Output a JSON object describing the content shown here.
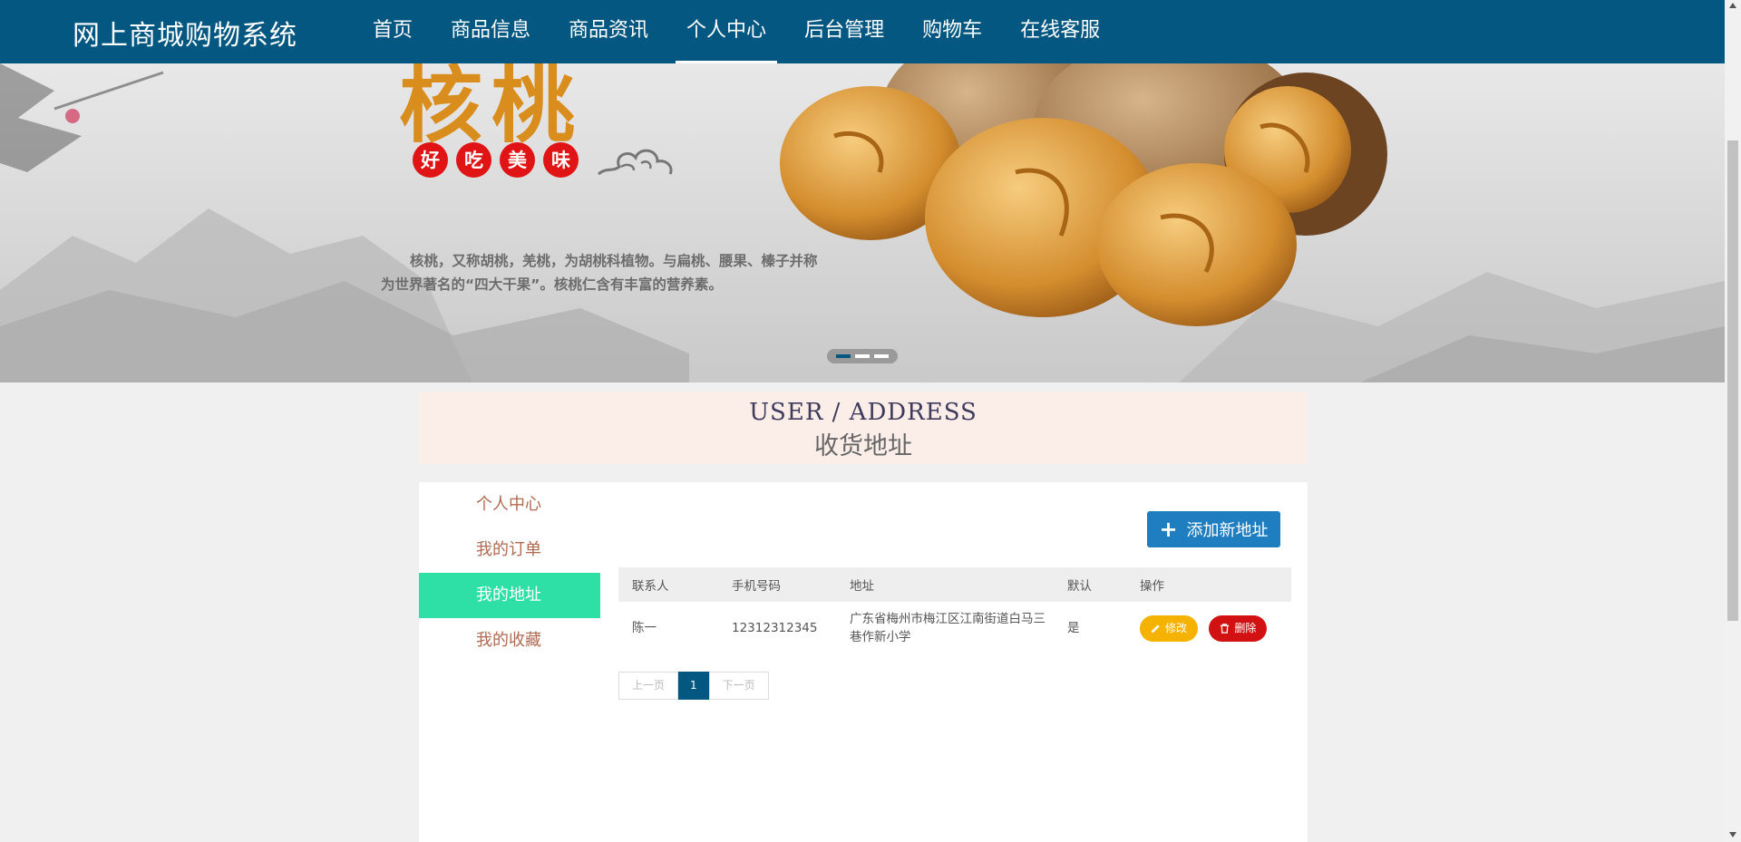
{
  "header": {
    "brand": "网上商城购物系统",
    "nav": [
      {
        "label": "首页"
      },
      {
        "label": "商品信息"
      },
      {
        "label": "商品资讯"
      },
      {
        "label": "个人中心",
        "active": true
      },
      {
        "label": "后台管理"
      },
      {
        "label": "购物车"
      },
      {
        "label": "在线客服"
      }
    ]
  },
  "banner": {
    "title": "核桃",
    "badges": [
      "好",
      "吃",
      "美",
      "味"
    ],
    "description": "核桃，又称胡桃，羌桃，为胡桃科植物。与扁桃、腰果、榛子并称为世界著名的“四大干果”。核桃仁含有丰富的营养素。",
    "slides": 3,
    "active_slide": 1
  },
  "section": {
    "title_en": "USER / ADDRESS",
    "title_cn": "收货地址"
  },
  "sidebar": {
    "items": [
      {
        "label": "个人中心"
      },
      {
        "label": "我的订单"
      },
      {
        "label": "我的地址",
        "active": true
      },
      {
        "label": "我的收藏"
      }
    ]
  },
  "actions": {
    "add_label": "添加新地址"
  },
  "table": {
    "headers": [
      "联系人",
      "手机号码",
      "地址",
      "默认",
      "操作"
    ],
    "rows": [
      {
        "contact": "陈一",
        "phone": "12312312345",
        "address": "广东省梅州市梅江区江南街道白马三巷作新小学",
        "default": "是",
        "edit_label": "修改",
        "delete_label": "删除"
      }
    ]
  },
  "pager": {
    "prev": "上一页",
    "current": "1",
    "next": "下一页"
  },
  "colors": {
    "nav_bg": "#045780",
    "sidebar_active": "#2ee0a6",
    "add_button": "#1f7ec0",
    "edit_button": "#f5b300",
    "delete_button": "#d21212"
  }
}
